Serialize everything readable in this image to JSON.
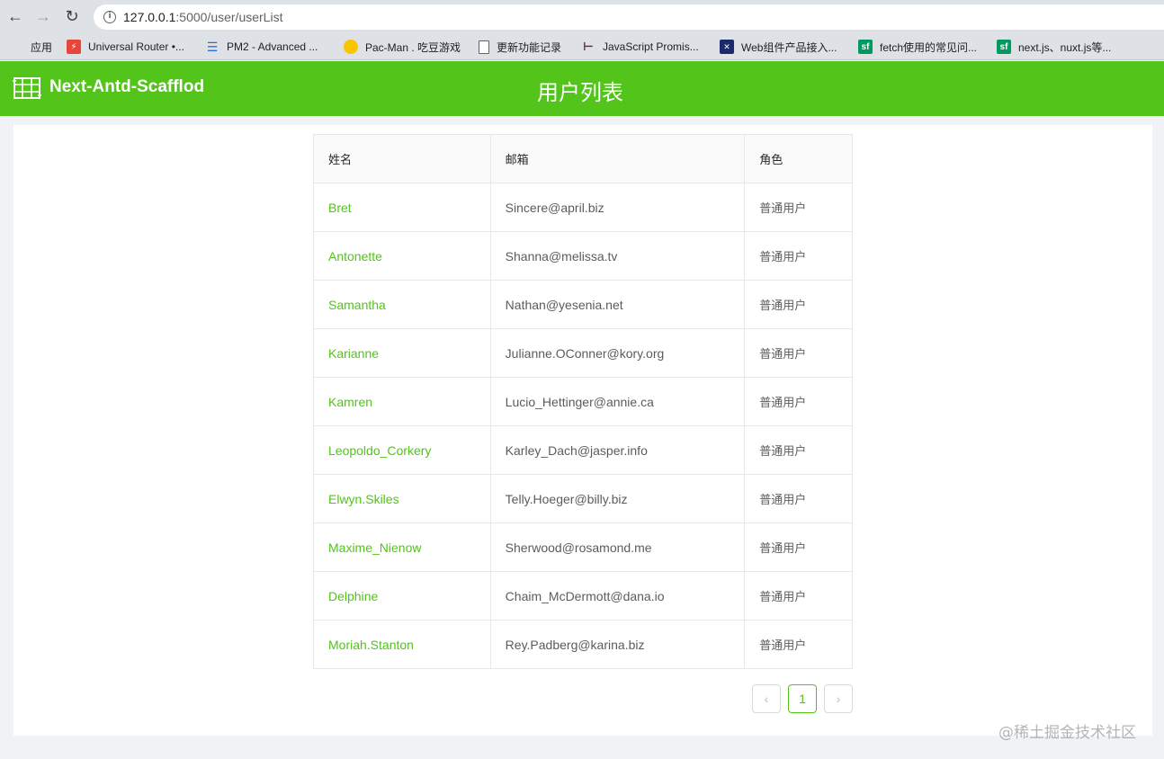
{
  "browser": {
    "url_host": "127.0.0.1",
    "url_rest": ":5000/user/userList",
    "bookmarks": [
      {
        "label": "应用",
        "icon": "apps-grid-icon"
      },
      {
        "label": "Universal Router •...",
        "icon": "universal-router-icon",
        "color": "#e8453c"
      },
      {
        "label": "PM2 - Advanced ...",
        "icon": "pm2-icon",
        "color": "#2d6cdf"
      },
      {
        "label": "Pac-Man . 吃豆游戏",
        "icon": "pacman-icon",
        "color": "#f9c400"
      },
      {
        "label": "更新功能记录",
        "icon": "document-icon"
      },
      {
        "label": "JavaScript Promis...",
        "icon": "js-icon",
        "color": "#7a2048"
      },
      {
        "label": "Web组件产品接入...",
        "icon": "web-component-icon",
        "color": "#1a2a6c"
      },
      {
        "label": "fetch使用的常见问...",
        "icon": "segmentfault-icon",
        "color": "#009a61"
      },
      {
        "label": "next.js、nuxt.js等...",
        "icon": "segmentfault-icon",
        "color": "#009a61"
      }
    ]
  },
  "header": {
    "logo_text": "Next-Antd-Scafflod",
    "title": "用户列表",
    "bg_color": "#52c41a"
  },
  "table": {
    "columns": [
      "姓名",
      "邮箱",
      "角色"
    ],
    "rows": [
      {
        "name": "Bret",
        "email": "Sincere@april.biz",
        "role": "普通用户"
      },
      {
        "name": "Antonette",
        "email": "Shanna@melissa.tv",
        "role": "普通用户"
      },
      {
        "name": "Samantha",
        "email": "Nathan@yesenia.net",
        "role": "普通用户"
      },
      {
        "name": "Karianne",
        "email": "Julianne.OConner@kory.org",
        "role": "普通用户"
      },
      {
        "name": "Kamren",
        "email": "Lucio_Hettinger@annie.ca",
        "role": "普通用户"
      },
      {
        "name": "Leopoldo_Corkery",
        "email": "Karley_Dach@jasper.info",
        "role": "普通用户"
      },
      {
        "name": "Elwyn.Skiles",
        "email": "Telly.Hoeger@billy.biz",
        "role": "普通用户"
      },
      {
        "name": "Maxime_Nienow",
        "email": "Sherwood@rosamond.me",
        "role": "普通用户"
      },
      {
        "name": "Delphine",
        "email": "Chaim_McDermott@dana.io",
        "role": "普通用户"
      },
      {
        "name": "Moriah.Stanton",
        "email": "Rey.Padberg@karina.biz",
        "role": "普通用户"
      }
    ]
  },
  "pagination": {
    "prev": "‹",
    "current": "1",
    "next": "›"
  },
  "watermark": "@稀土掘金技术社区"
}
